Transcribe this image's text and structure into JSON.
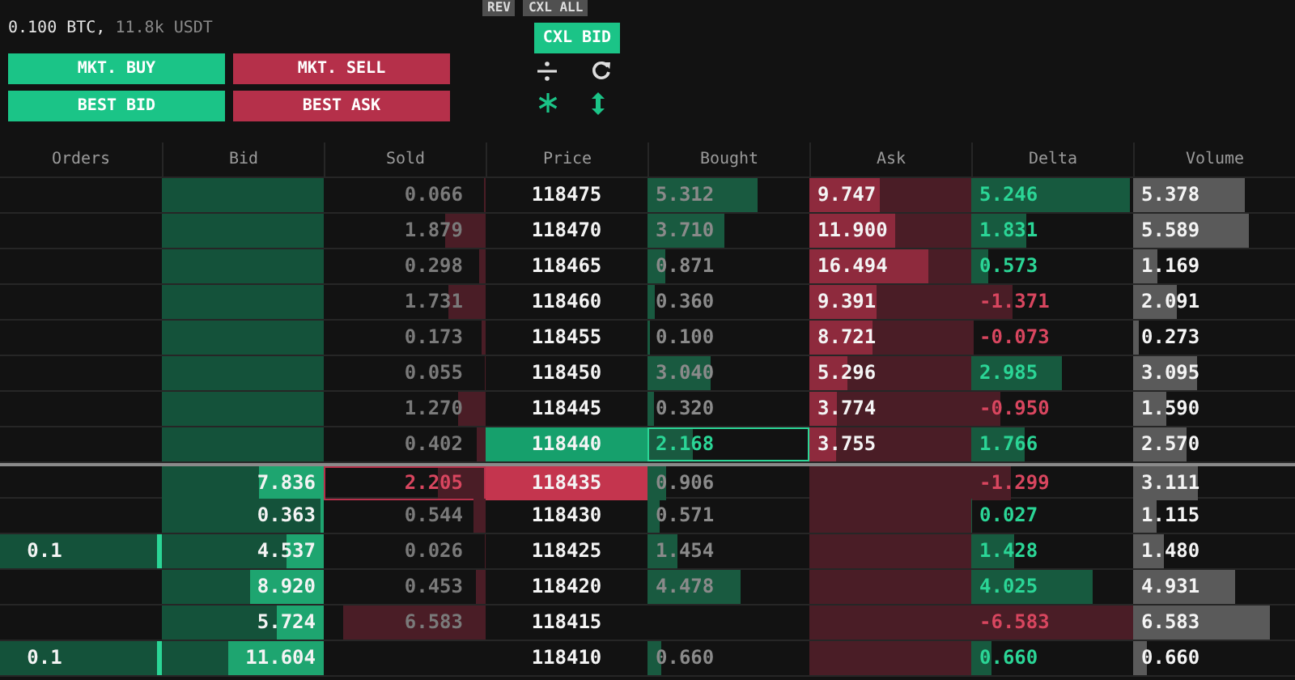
{
  "account": {
    "position": "0.100 BTC,",
    "value": "11.8k USDT"
  },
  "order_buttons": [
    {
      "label": "MKT. BUY",
      "kind": "buy"
    },
    {
      "label": "MKT. SELL",
      "kind": "sell"
    },
    {
      "label": "BEST BID",
      "kind": "buy"
    },
    {
      "label": "BEST ASK",
      "kind": "sell"
    }
  ],
  "controls": [
    {
      "label": "REV",
      "kind": "neutral"
    },
    {
      "label": "CXL ALL",
      "kind": "neutral"
    },
    {
      "label": "CXL BID",
      "kind": "buy"
    }
  ],
  "columns": [
    "Orders",
    "Bid",
    "Sold",
    "Price",
    "Bought",
    "Ask",
    "Delta",
    "Volume"
  ],
  "rows": [
    {
      "sold": {
        "text": "0.066",
        "highlight": false
      },
      "price": {
        "text": "118475",
        "kind": "plain"
      },
      "bought": {
        "text": "5.312",
        "highlight": false
      },
      "ask": {
        "text": "9.747"
      },
      "delta": {
        "text": "5.246",
        "kind": "up"
      },
      "volume": {
        "text": "5.378"
      }
    },
    {
      "sold": {
        "text": "1.879",
        "highlight": false
      },
      "price": {
        "text": "118470",
        "kind": "plain"
      },
      "bought": {
        "text": "3.710",
        "highlight": false
      },
      "ask": {
        "text": "11.900"
      },
      "delta": {
        "text": "1.831",
        "kind": "up"
      },
      "volume": {
        "text": "5.589"
      }
    },
    {
      "sold": {
        "text": "0.298",
        "highlight": false
      },
      "price": {
        "text": "118465",
        "kind": "plain"
      },
      "bought": {
        "text": "0.871",
        "highlight": false
      },
      "ask": {
        "text": "16.494"
      },
      "delta": {
        "text": "0.573",
        "kind": "up"
      },
      "volume": {
        "text": "1.169"
      }
    },
    {
      "sold": {
        "text": "1.731",
        "highlight": false
      },
      "price": {
        "text": "118460",
        "kind": "plain"
      },
      "bought": {
        "text": "0.360",
        "highlight": false
      },
      "ask": {
        "text": "9.391"
      },
      "delta": {
        "text": "-1.371",
        "kind": "down"
      },
      "volume": {
        "text": "2.091"
      }
    },
    {
      "sold": {
        "text": "0.173",
        "highlight": false
      },
      "price": {
        "text": "118455",
        "kind": "plain"
      },
      "bought": {
        "text": "0.100",
        "highlight": false
      },
      "ask": {
        "text": "8.721"
      },
      "delta": {
        "text": "-0.073",
        "kind": "down"
      },
      "volume": {
        "text": "0.273"
      }
    },
    {
      "sold": {
        "text": "0.055",
        "highlight": false
      },
      "price": {
        "text": "118450",
        "kind": "plain"
      },
      "bought": {
        "text": "3.040",
        "highlight": false
      },
      "ask": {
        "text": "5.296"
      },
      "delta": {
        "text": "2.985",
        "kind": "up"
      },
      "volume": {
        "text": "3.095"
      }
    },
    {
      "sold": {
        "text": "1.270",
        "highlight": false
      },
      "price": {
        "text": "118445",
        "kind": "plain"
      },
      "bought": {
        "text": "0.320",
        "highlight": false
      },
      "ask": {
        "text": "3.774"
      },
      "delta": {
        "text": "-0.950",
        "kind": "down"
      },
      "volume": {
        "text": "1.590"
      }
    },
    {
      "sold": {
        "text": "0.402",
        "highlight": false
      },
      "price": {
        "text": "118440",
        "kind": "buy"
      },
      "bought": {
        "text": "2.168",
        "highlight": true
      },
      "ask": {
        "text": "3.755"
      },
      "delta": {
        "text": "1.766",
        "kind": "up"
      },
      "volume": {
        "text": "2.570"
      }
    },
    {
      "bid": {
        "text": "7.836"
      },
      "sold": {
        "text": "2.205",
        "highlight": true
      },
      "price": {
        "text": "118435",
        "kind": "sell"
      },
      "bought": {
        "text": "0.906",
        "highlight": false
      },
      "delta": {
        "text": "-1.299",
        "kind": "down"
      },
      "volume": {
        "text": "3.111"
      }
    },
    {
      "bid": {
        "text": "0.363"
      },
      "sold": {
        "text": "0.544",
        "highlight": false
      },
      "price": {
        "text": "118430",
        "kind": "plain"
      },
      "bought": {
        "text": "0.571",
        "highlight": false
      },
      "delta": {
        "text": "0.027",
        "kind": "up"
      },
      "volume": {
        "text": "1.115"
      }
    },
    {
      "orders": {
        "text": "0.1"
      },
      "bid": {
        "text": "4.537"
      },
      "sold": {
        "text": "0.026",
        "highlight": false
      },
      "price": {
        "text": "118425",
        "kind": "plain"
      },
      "bought": {
        "text": "1.454",
        "highlight": false
      },
      "delta": {
        "text": "1.428",
        "kind": "up"
      },
      "volume": {
        "text": "1.480"
      }
    },
    {
      "bid": {
        "text": "8.920"
      },
      "sold": {
        "text": "0.453",
        "highlight": false
      },
      "price": {
        "text": "118420",
        "kind": "plain"
      },
      "bought": {
        "text": "4.478",
        "highlight": false
      },
      "delta": {
        "text": "4.025",
        "kind": "up"
      },
      "volume": {
        "text": "4.931"
      }
    },
    {
      "bid": {
        "text": "5.724"
      },
      "sold": {
        "text": "6.583",
        "highlight": false
      },
      "price": {
        "text": "118415",
        "kind": "plain"
      },
      "delta": {
        "text": "-6.583",
        "kind": "down"
      },
      "volume": {
        "text": "6.583"
      }
    },
    {
      "orders": {
        "text": "0.1"
      },
      "bid": {
        "text": "11.604"
      },
      "price": {
        "text": "118410",
        "kind": "plain"
      },
      "bought": {
        "text": "0.660",
        "highlight": false
      },
      "delta": {
        "text": "0.660",
        "kind": "up"
      },
      "volume": {
        "text": "0.660"
      }
    }
  ]
}
